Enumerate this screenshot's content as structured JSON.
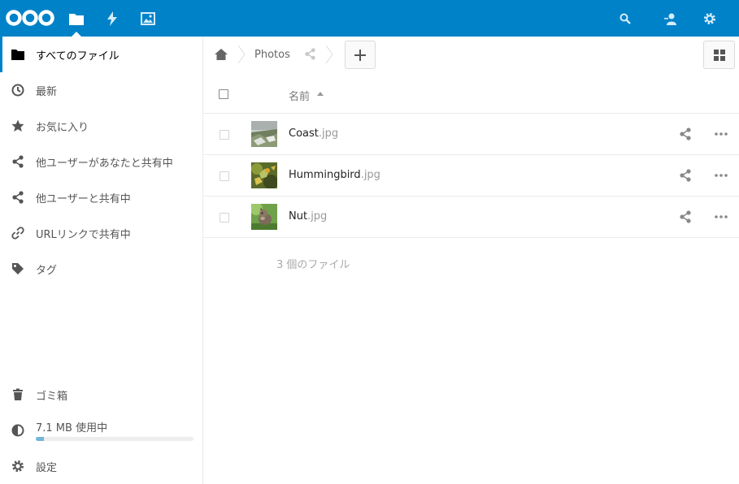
{
  "header": {
    "apps": [
      {
        "name": "files",
        "icon": "folder-icon",
        "active": true
      },
      {
        "name": "activity",
        "icon": "bolt-icon",
        "active": false
      },
      {
        "name": "gallery",
        "icon": "image-icon",
        "active": false
      }
    ],
    "right_icons": [
      "search-icon",
      "contacts-icon",
      "settings-icon"
    ],
    "accent_color": "#0082c9"
  },
  "sidebar": {
    "items": [
      {
        "label": "すべてのファイル",
        "icon": "folder-icon",
        "active": true
      },
      {
        "label": "最新",
        "icon": "clock-icon"
      },
      {
        "label": "お気に入り",
        "icon": "star-icon"
      },
      {
        "label": "他ユーザーがあなたと共有中",
        "icon": "share-icon"
      },
      {
        "label": "他ユーザーと共有中",
        "icon": "share-icon"
      },
      {
        "label": "URLリンクで共有中",
        "icon": "link-icon"
      },
      {
        "label": "タグ",
        "icon": "tag-icon"
      }
    ],
    "trash_label": "ゴミ箱",
    "quota": {
      "label": "7.1 MB 使用中",
      "used_fraction": 0.05
    },
    "settings_label": "設定"
  },
  "breadcrumb": {
    "home_icon": "home-icon",
    "folder": "Photos",
    "share_icon": "share-icon",
    "add_icon": "plus-icon"
  },
  "view_toggle_icon": "grid-icon",
  "table": {
    "name_header": "名前",
    "sort": "ascending",
    "files": [
      {
        "base": "Coast",
        "ext": ".jpg"
      },
      {
        "base": "Hummingbird",
        "ext": ".jpg"
      },
      {
        "base": "Nut",
        "ext": ".jpg"
      }
    ],
    "summary": "3 個のファイル"
  }
}
